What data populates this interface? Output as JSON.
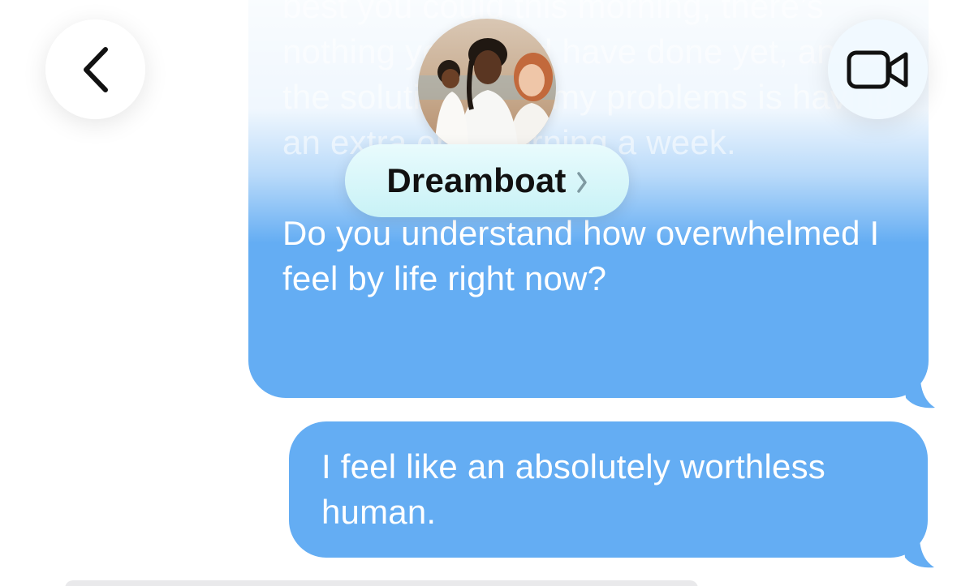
{
  "conversation": {
    "contact_name": "Dreamboat",
    "messages": [
      {
        "paragraphs": [
          "best you could this morning, there’s nothing you could have done yet, and the solution to all my problems is having an extra one morning a week.",
          "Do you understand how overwhelmed I feel by life right now?"
        ]
      },
      {
        "text": "I feel like an absolutely worthless human."
      }
    ]
  },
  "icons": {
    "back": "chevron-left-icon",
    "video": "video-camera-icon",
    "name_chevron": "chevron-right-icon"
  },
  "colors": {
    "bubble": "#64adf3",
    "pill": "#d8f6f9",
    "bubble_text": "#ffffff"
  }
}
